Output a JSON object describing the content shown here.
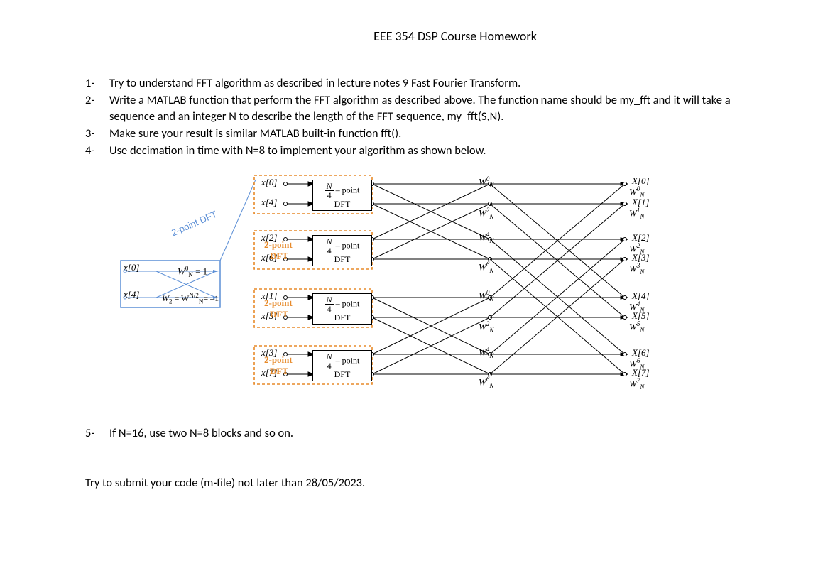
{
  "title": "EEE 354 DSP Course Homework",
  "items": {
    "n1": "1-",
    "t1": "Try to understand FFT algorithm as described in lecture notes 9 Fast Fourier Transform.",
    "n2": "2-",
    "t2": "Write a MATLAB function that perform the FFT algorithm as described above. The function name should be my_fft and it will take a sequence and an integer N to describe the length of the FFT sequence, my_fft(S,N).",
    "n3": "3-",
    "t3": "Make sure your result is similar MATLAB built-in function fft().",
    "n4": "4-",
    "t4": "Use decimation in time with N=8 to implement your algorithm as shown below.",
    "n5": "5-",
    "t5": "If N=16, use two N=8 blocks and so on."
  },
  "closing": "Try to submit your code (m-file) not later than 28/05/2023.",
  "diagram": {
    "two_point_dft": "2-point DFT",
    "inputs": {
      "i0": "x[0]",
      "i1": "x[4]",
      "i2": "x[2]",
      "i3": "x[6]",
      "i4": "x[1]",
      "i5": "x[5]",
      "i6": "x[3]",
      "i7": "x[7]"
    },
    "left_small": {
      "a": "x[0]",
      "b": "x[4]",
      "w0": "W",
      "w0exp": "0",
      "w0sub": "N",
      "w0eq": "= 1",
      "w2": "W",
      "w2sub": "2",
      "w2eq": "= W",
      "w2expN": "N/2",
      "w2subN": "N",
      "w2end": "= –1"
    },
    "stage2": {
      "lbl": "2-point",
      "dft": "DFT"
    },
    "n4box": {
      "top": "– point",
      "bot": "DFT",
      "frac_n": "N",
      "frac_d": "4"
    },
    "mid_w": {
      "w0": "0",
      "w2": "2",
      "w4": "4",
      "w6": "6"
    },
    "outputs": {
      "o0": "X[0]",
      "o1": "X[1]",
      "o2": "X[2]",
      "o3": "X[3]",
      "o4": "X[4]",
      "o5": "X[5]",
      "o6": "X[6]",
      "o7": "X[7]"
    },
    "right_w": {
      "w0": "0",
      "w1": "1",
      "w2": "2",
      "w3": "3",
      "w4": "4",
      "w5": "5",
      "w6": "6",
      "w7": "7"
    }
  }
}
